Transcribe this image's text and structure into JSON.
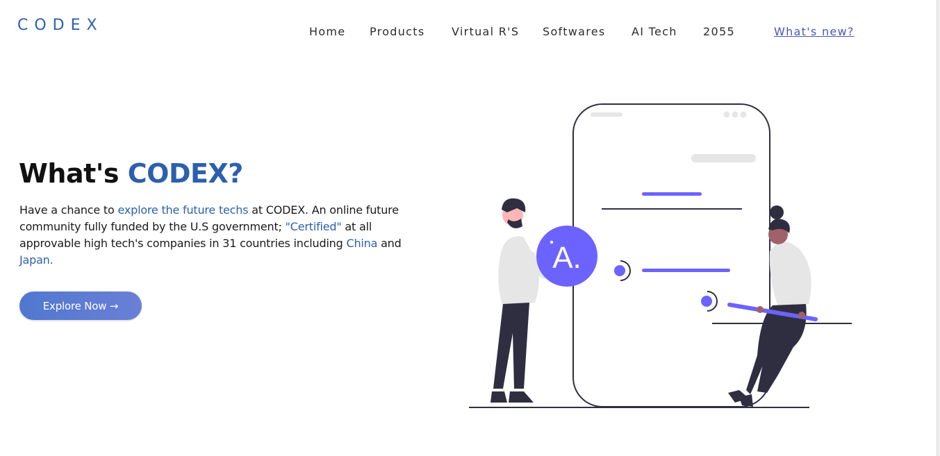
{
  "brand": {
    "logo": "CODEX"
  },
  "nav": {
    "items": [
      "Home",
      "Products",
      "Virtual R'S",
      "Softwares",
      "AI Tech",
      "2055"
    ],
    "whats_new": "What's new?"
  },
  "hero": {
    "title_main": "What's ",
    "title_accent": "CODEX?",
    "paragraph": {
      "p1": "Have a chance to ",
      "h1": "explore the future techs",
      "p2": " at CODEX. An online future community fully funded by the U.S government; ",
      "h2": "\"Certified\"",
      "p3": " at all approvable high tech's companies in 31 countries including ",
      "h3": "China",
      "p4": " and ",
      "h4": "Japan.",
      "p5": ""
    },
    "cta_label": "Explore Now →"
  },
  "illustration": {
    "badge_text": "A.",
    "colors": {
      "accent": "#6c63ff",
      "dark": "#2f2e41",
      "light": "#e6e6e6",
      "skin_light": "#ffb6b6",
      "skin_dark": "#a0616a"
    }
  },
  "colors": {
    "brand_blue": "#2d5fae",
    "link_purple": "#4a56b8"
  }
}
